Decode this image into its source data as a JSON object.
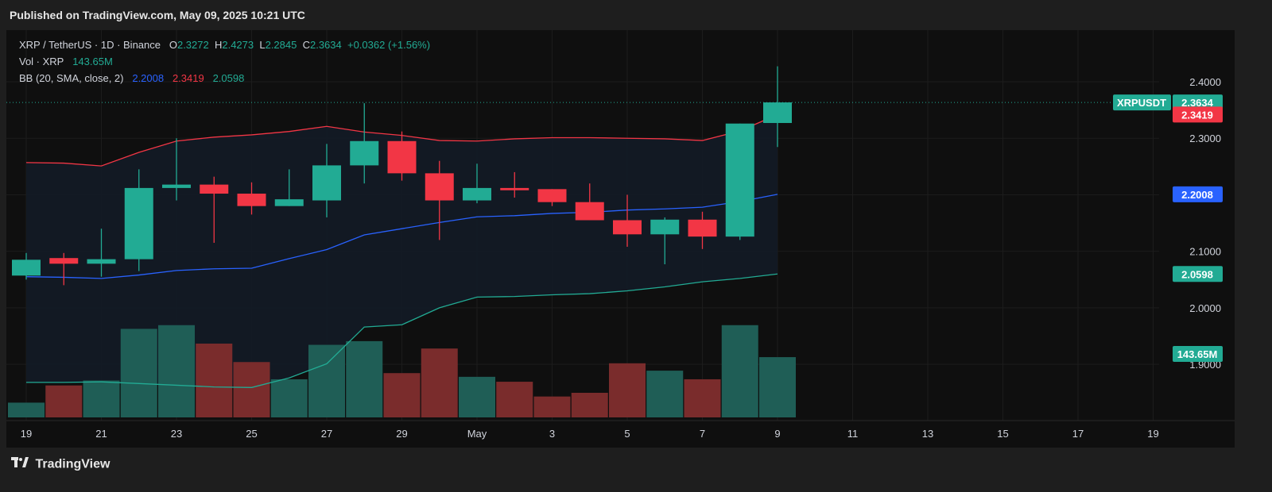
{
  "published": "Published on TradingView.com, May 09, 2025 10:21 UTC",
  "legend": {
    "symbol": "XRP / TetherUS · 1D · Binance",
    "o_label": "O",
    "o": "2.3272",
    "h_label": "H",
    "h": "2.4273",
    "l_label": "L",
    "l": "2.2845",
    "c_label": "C",
    "c": "2.3634",
    "change": "+0.0362 (+1.56%)",
    "vol_label": "Vol · XRP",
    "vol": "143.65M",
    "bb_label": "BB (20, SMA, close, 2)",
    "bb_basis": "2.2008",
    "bb_upper": "2.3419",
    "bb_lower": "2.0598"
  },
  "footer": {
    "brand": "TradingView"
  },
  "colors": {
    "up": "#22ab94",
    "down": "#f23645",
    "vol_up": "#1f5e56",
    "vol_down": "#7a2c2c",
    "bb_basis": "#2962ff",
    "bb_upper": "#f23645",
    "bb_lower": "#22ab94",
    "bb_fill": "#131b26"
  },
  "chart_data": {
    "type": "candlestick",
    "symbol": "XRPUSDT",
    "x_tick_labels": [
      "19",
      "21",
      "23",
      "25",
      "27",
      "29",
      "May",
      "3",
      "5",
      "7",
      "9",
      "11",
      "13",
      "15",
      "17",
      "19"
    ],
    "y_tick_labels": [
      "2.4000",
      "2.3000",
      "2.2000",
      "2.1000",
      "2.0000",
      "1.9000"
    ],
    "ylim": [
      1.8,
      2.44
    ],
    "candles": [
      {
        "date": "2025-04-19",
        "o": 2.057,
        "h": 2.097,
        "l": 2.05,
        "c": 2.085
      },
      {
        "date": "2025-04-20",
        "o": 2.088,
        "h": 2.097,
        "l": 2.04,
        "c": 2.078
      },
      {
        "date": "2025-04-21",
        "o": 2.078,
        "h": 2.14,
        "l": 2.055,
        "c": 2.086
      },
      {
        "date": "2025-04-22",
        "o": 2.086,
        "h": 2.245,
        "l": 2.065,
        "c": 2.212
      },
      {
        "date": "2025-04-23",
        "o": 2.212,
        "h": 2.3,
        "l": 2.19,
        "c": 2.218
      },
      {
        "date": "2025-04-24",
        "o": 2.218,
        "h": 2.232,
        "l": 2.115,
        "c": 2.202
      },
      {
        "date": "2025-04-25",
        "o": 2.202,
        "h": 2.222,
        "l": 2.165,
        "c": 2.18
      },
      {
        "date": "2025-04-26",
        "o": 2.18,
        "h": 2.245,
        "l": 2.18,
        "c": 2.192
      },
      {
        "date": "2025-04-27",
        "o": 2.19,
        "h": 2.29,
        "l": 2.16,
        "c": 2.252
      },
      {
        "date": "2025-04-28",
        "o": 2.252,
        "h": 2.362,
        "l": 2.22,
        "c": 2.295
      },
      {
        "date": "2025-04-29",
        "o": 2.295,
        "h": 2.312,
        "l": 2.225,
        "c": 2.238
      },
      {
        "date": "2025-04-30",
        "o": 2.238,
        "h": 2.26,
        "l": 2.12,
        "c": 2.19
      },
      {
        "date": "2025-05-01",
        "o": 2.19,
        "h": 2.255,
        "l": 2.185,
        "c": 2.212
      },
      {
        "date": "2025-05-02",
        "o": 2.212,
        "h": 2.24,
        "l": 2.195,
        "c": 2.208
      },
      {
        "date": "2025-05-03",
        "o": 2.21,
        "h": 2.21,
        "l": 2.18,
        "c": 2.187
      },
      {
        "date": "2025-05-04",
        "o": 2.187,
        "h": 2.22,
        "l": 2.155,
        "c": 2.155
      },
      {
        "date": "2025-05-05",
        "o": 2.155,
        "h": 2.2,
        "l": 2.108,
        "c": 2.13
      },
      {
        "date": "2025-05-06",
        "o": 2.13,
        "h": 2.16,
        "l": 2.077,
        "c": 2.156
      },
      {
        "date": "2025-05-07",
        "o": 2.156,
        "h": 2.17,
        "l": 2.104,
        "c": 2.126
      },
      {
        "date": "2025-05-08",
        "o": 2.126,
        "h": 2.326,
        "l": 2.12,
        "c": 2.326
      },
      {
        "date": "2025-05-09",
        "o": 2.327,
        "h": 2.4273,
        "l": 2.2845,
        "c": 2.3634
      }
    ],
    "bb_upper": [
      2.257,
      2.256,
      2.251,
      2.275,
      2.295,
      2.302,
      2.306,
      2.312,
      2.321,
      2.311,
      2.305,
      2.296,
      2.295,
      2.299,
      2.301,
      2.301,
      2.3,
      2.299,
      2.296,
      2.313,
      2.3419
    ],
    "bb_basis": [
      2.055,
      2.054,
      2.052,
      2.058,
      2.066,
      2.069,
      2.07,
      2.087,
      2.103,
      2.129,
      2.14,
      2.151,
      2.161,
      2.163,
      2.167,
      2.169,
      2.173,
      2.175,
      2.178,
      2.188,
      2.2008
    ],
    "bb_lower": [
      1.868,
      1.868,
      1.869,
      1.866,
      1.863,
      1.86,
      1.859,
      1.876,
      1.901,
      1.966,
      1.97,
      2.0,
      2.019,
      2.02,
      2.023,
      2.025,
      2.03,
      2.037,
      2.046,
      2.052,
      2.0598
    ],
    "volume": [
      12,
      26,
      30,
      72,
      75,
      60,
      45,
      31,
      59,
      62,
      36,
      56,
      33,
      29,
      17,
      20,
      44,
      38,
      31,
      75,
      49
    ],
    "volume_last": "143.65M",
    "price_badges": {
      "last": "2.3634",
      "bb_upper": "2.3419",
      "bb_basis": "2.2008",
      "bb_lower": "2.0598",
      "volume": "143.65M"
    }
  }
}
